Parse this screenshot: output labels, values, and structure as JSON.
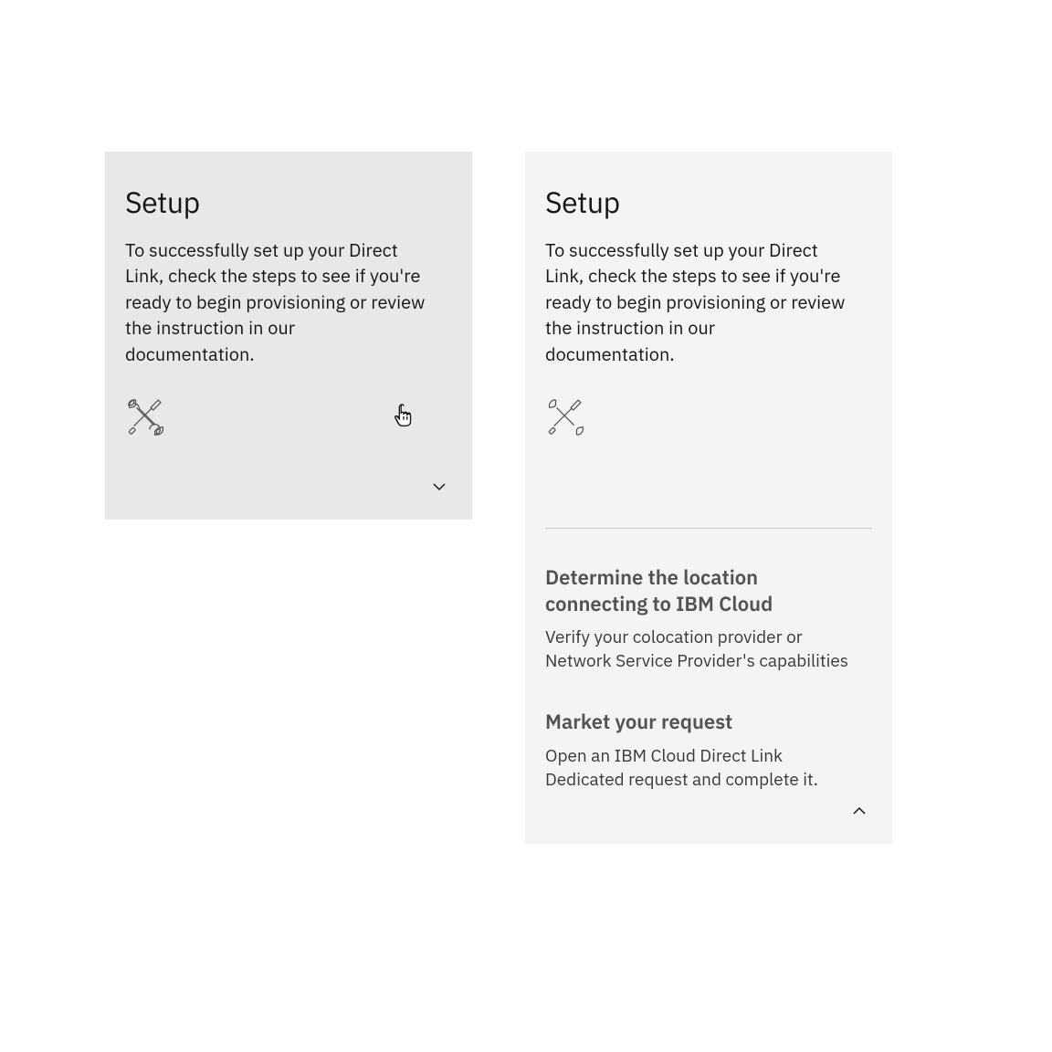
{
  "leftCard": {
    "title": "Setup",
    "description": "To successfully set up your Direct Link, check the steps to see if you're ready to begin provisioning or review the instruction in our documentation."
  },
  "rightCard": {
    "title": "Setup",
    "description": "To successfully set up your Direct Link, check the steps to see if you're ready to begin provisioning or review the instruction in our documentation.",
    "steps": [
      {
        "title": "Determine the location connecting to IBM Cloud",
        "description": "Verify your colocation provider or Network Service Provider's capabilities"
      },
      {
        "title": "Market your request",
        "description": "Open an IBM Cloud Direct Link Dedicated request and complete it."
      }
    ]
  }
}
